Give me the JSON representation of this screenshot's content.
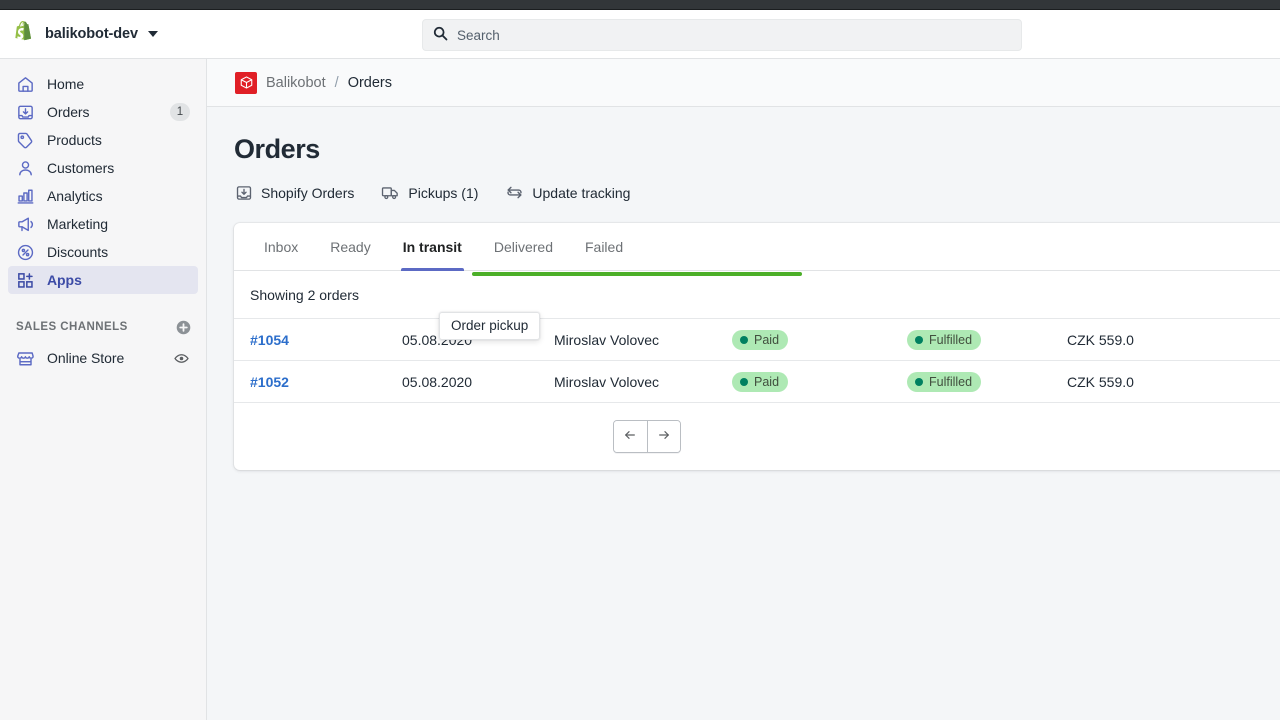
{
  "topbar": {
    "shop_name": "balikobot-dev",
    "logo_icon": "shopify-bag-icon",
    "caret_icon": "chevron-down-icon",
    "search": {
      "icon": "search-icon",
      "placeholder": "Search",
      "value": ""
    }
  },
  "sidebar": {
    "items": [
      {
        "label": "Home",
        "icon": "home-icon",
        "badge": "",
        "active": false
      },
      {
        "label": "Orders",
        "icon": "orders-icon",
        "badge": "1",
        "active": false
      },
      {
        "label": "Products",
        "icon": "products-icon",
        "badge": "",
        "active": false
      },
      {
        "label": "Customers",
        "icon": "customers-icon",
        "badge": "",
        "active": false
      },
      {
        "label": "Analytics",
        "icon": "analytics-icon",
        "badge": "",
        "active": false
      },
      {
        "label": "Marketing",
        "icon": "marketing-icon",
        "badge": "",
        "active": false
      },
      {
        "label": "Discounts",
        "icon": "discounts-icon",
        "badge": "",
        "active": false
      },
      {
        "label": "Apps",
        "icon": "apps-icon",
        "badge": "",
        "active": true
      }
    ],
    "sales_channels": {
      "title": "SALES CHANNELS",
      "add_icon": "plus-circle-icon",
      "items": [
        {
          "label": "Online Store",
          "icon": "store-icon",
          "action_icon": "eye-icon"
        }
      ]
    }
  },
  "breadcrumb": {
    "app_icon": "balikobot-box-icon",
    "app_name": "Balikobot",
    "separator": "/",
    "current": "Orders"
  },
  "page": {
    "title": "Orders",
    "actions": [
      {
        "label": "Shopify Orders",
        "icon": "orders-import-icon"
      },
      {
        "label": "Pickups (1)",
        "icon": "truck-icon"
      },
      {
        "label": "Update tracking",
        "icon": "refresh-icon"
      }
    ]
  },
  "card": {
    "tabs": [
      {
        "label": "Inbox",
        "active": false
      },
      {
        "label": "Ready",
        "active": false
      },
      {
        "label": "In transit",
        "active": true
      },
      {
        "label": "Delivered",
        "active": false
      },
      {
        "label": "Failed",
        "active": false
      }
    ],
    "progress": {
      "percent": 100,
      "color": "#4caf28"
    },
    "showing_text": "Showing 2 orders",
    "rows": [
      {
        "order": "#1054",
        "date": "05.08.2020",
        "customer": "Miroslav Volovec",
        "payment": "Paid",
        "fulfillment": "Fulfilled",
        "total": "CZK 559.0"
      },
      {
        "order": "#1052",
        "date": "05.08.2020",
        "customer": "Miroslav Volovec",
        "payment": "Paid",
        "fulfillment": "Fulfilled",
        "total": "CZK 559.0"
      }
    ],
    "pager": {
      "prev_icon": "arrow-left-icon",
      "next_icon": "arrow-right-icon"
    }
  },
  "tooltip": {
    "text": "Order pickup"
  },
  "colors": {
    "accent": "#5c6ac4",
    "link": "#2c6ecb",
    "progress_green": "#4caf28",
    "badge_bg": "#aee9b4",
    "badge_dot": "#008060",
    "app_icon_red": "#e01f26"
  }
}
